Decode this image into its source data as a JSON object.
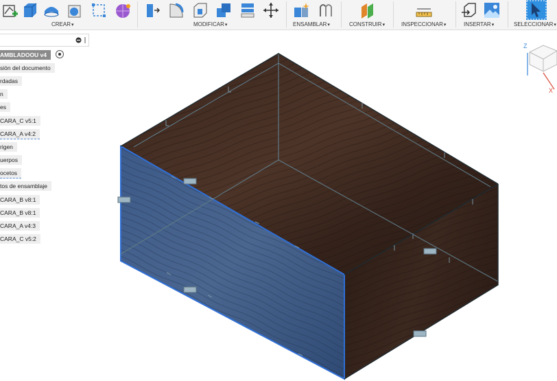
{
  "toolbar": {
    "groups": [
      {
        "label": "CREAR"
      },
      {
        "label": "MODIFICAR"
      },
      {
        "label": "ENSAMBLAR"
      },
      {
        "label": "CONSTRUIR"
      },
      {
        "label": "INSPECCIONAR"
      },
      {
        "label": "INSERTAR"
      },
      {
        "label": "SELECCIONAR"
      }
    ],
    "caret": "▾"
  },
  "browser": {
    "root": "AMBLADOOU v4",
    "items": [
      {
        "label": "sión del documento"
      },
      {
        "label": "rdadas"
      },
      {
        "label": "n"
      },
      {
        "label": "es"
      },
      {
        "label": "CARA_C v5:1"
      },
      {
        "label": "CARA_A v4:2"
      },
      {
        "label": "rigen"
      },
      {
        "label": "uerpos"
      },
      {
        "label": "ocetos"
      },
      {
        "label": "tos de ensamblaje"
      },
      {
        "label": "CARA_B v8:1"
      },
      {
        "label": "CARA_B v8:1"
      },
      {
        "label": "CARA_A v4:3"
      },
      {
        "label": "CARA_C v5:2"
      }
    ]
  },
  "viewcube": {
    "axis_z": "Z",
    "axis_x": "X"
  },
  "colors": {
    "accent": "#2f6fd6",
    "wood_dark": "#2a1c16",
    "wood_mid": "#4a3226",
    "selected_tint": "#3e5c8c"
  }
}
